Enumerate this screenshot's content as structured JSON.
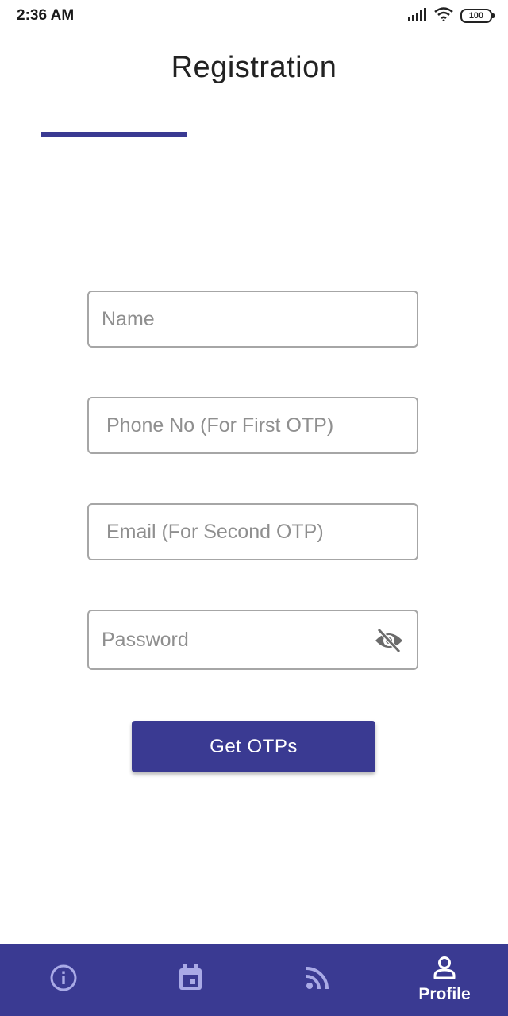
{
  "status_bar": {
    "time": "2:36 AM",
    "battery_level": "100",
    "icons": [
      "signal-icon",
      "wifi-icon",
      "battery-icon"
    ]
  },
  "header": {
    "title": "Registration"
  },
  "progress": {
    "fraction": 0.33,
    "color": "#3a3a92"
  },
  "form": {
    "name_placeholder": "Name",
    "phone_placeholder": "Phone No (For First OTP)",
    "email_placeholder": "Email (For Second OTP)",
    "password_placeholder": "Password",
    "password_toggle_icon": "eye-off-icon",
    "submit_label": "Get OTPs"
  },
  "bottom_nav": {
    "items": [
      {
        "icon": "info-icon",
        "label": "",
        "active": false
      },
      {
        "icon": "calendar-icon",
        "label": "",
        "active": false
      },
      {
        "icon": "rss-feed-icon",
        "label": "",
        "active": false
      },
      {
        "icon": "person-icon",
        "label": "Profile",
        "active": true
      }
    ],
    "background": "#3a3a92",
    "inactive_icon_color": "#a9aae6",
    "active_color": "#ffffff"
  },
  "colors": {
    "primary": "#3a3a92",
    "field_border": "#a6a6a6",
    "placeholder": "#8f8f8f"
  }
}
